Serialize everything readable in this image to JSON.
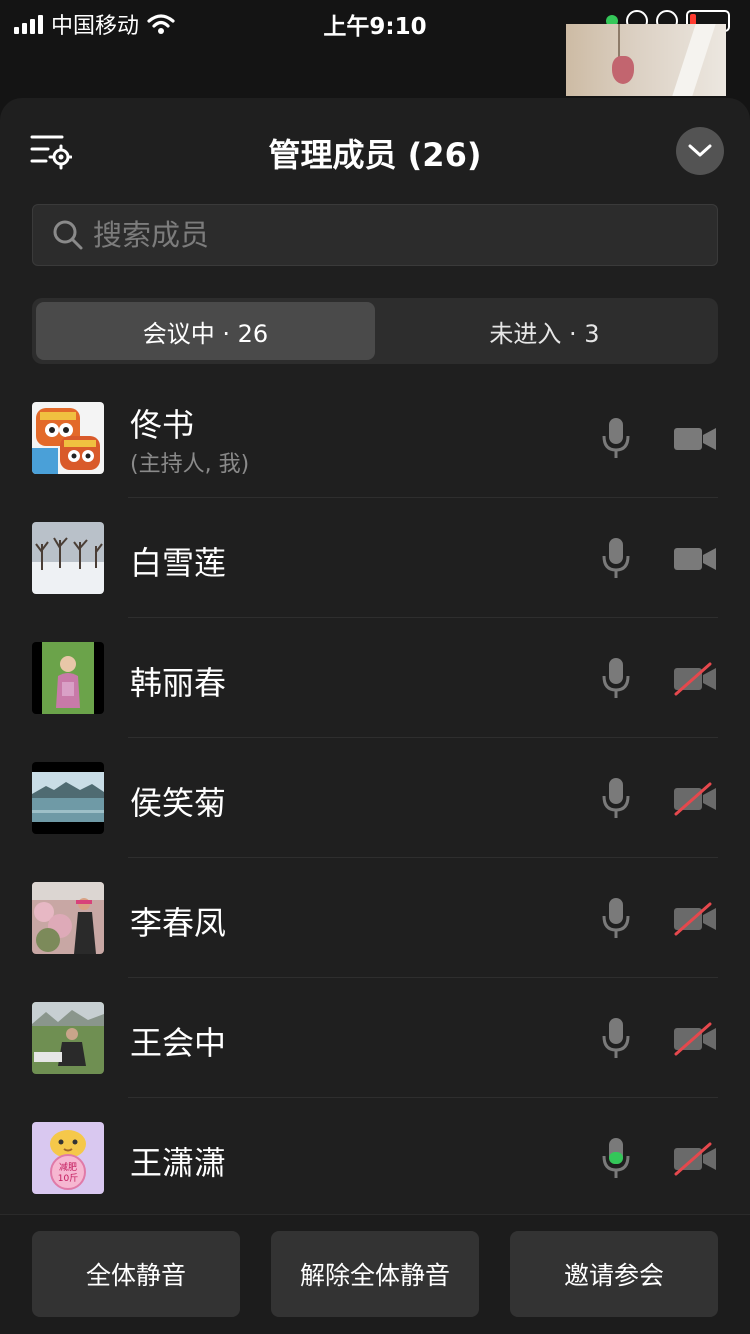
{
  "status_bar": {
    "carrier": "中国移动",
    "time": "上午9:10"
  },
  "header": {
    "title": "管理成员 (26)"
  },
  "search": {
    "placeholder": "搜索成员"
  },
  "tabs": [
    {
      "label": "会议中 · 26",
      "active": true
    },
    {
      "label": "未进入 · 3",
      "active": false
    }
  ],
  "members": [
    {
      "name": "佟书",
      "role": "(主持人, 我)",
      "mic": "on",
      "camera": "on",
      "avatar": "lion-dance-avatar"
    },
    {
      "name": "白雪莲",
      "role": "",
      "mic": "on",
      "camera": "on",
      "avatar": "snowy-trees-avatar"
    },
    {
      "name": "韩丽春",
      "role": "",
      "mic": "on",
      "camera": "off",
      "avatar": "woman-garden-avatar"
    },
    {
      "name": "侯笑菊",
      "role": "",
      "mic": "on",
      "camera": "off",
      "avatar": "lake-landscape-avatar"
    },
    {
      "name": "李春凤",
      "role": "",
      "mic": "on",
      "camera": "off",
      "avatar": "blossom-woman-avatar"
    },
    {
      "name": "王会中",
      "role": "",
      "mic": "on",
      "camera": "off",
      "avatar": "man-field-avatar"
    },
    {
      "name": "王潇潇",
      "role": "",
      "mic": "speaking",
      "camera": "off",
      "avatar": "cartoon-chick-avatar",
      "avatar_text": "减肥10斤"
    }
  ],
  "actions": {
    "mute_all": "全体静音",
    "unmute_all": "解除全体静音",
    "invite": "邀请参会"
  },
  "colors": {
    "background": "#141414",
    "sheet": "#1f1f1f",
    "speaking_mic": "#34c759",
    "camera_off_slash": "#e5484d"
  }
}
